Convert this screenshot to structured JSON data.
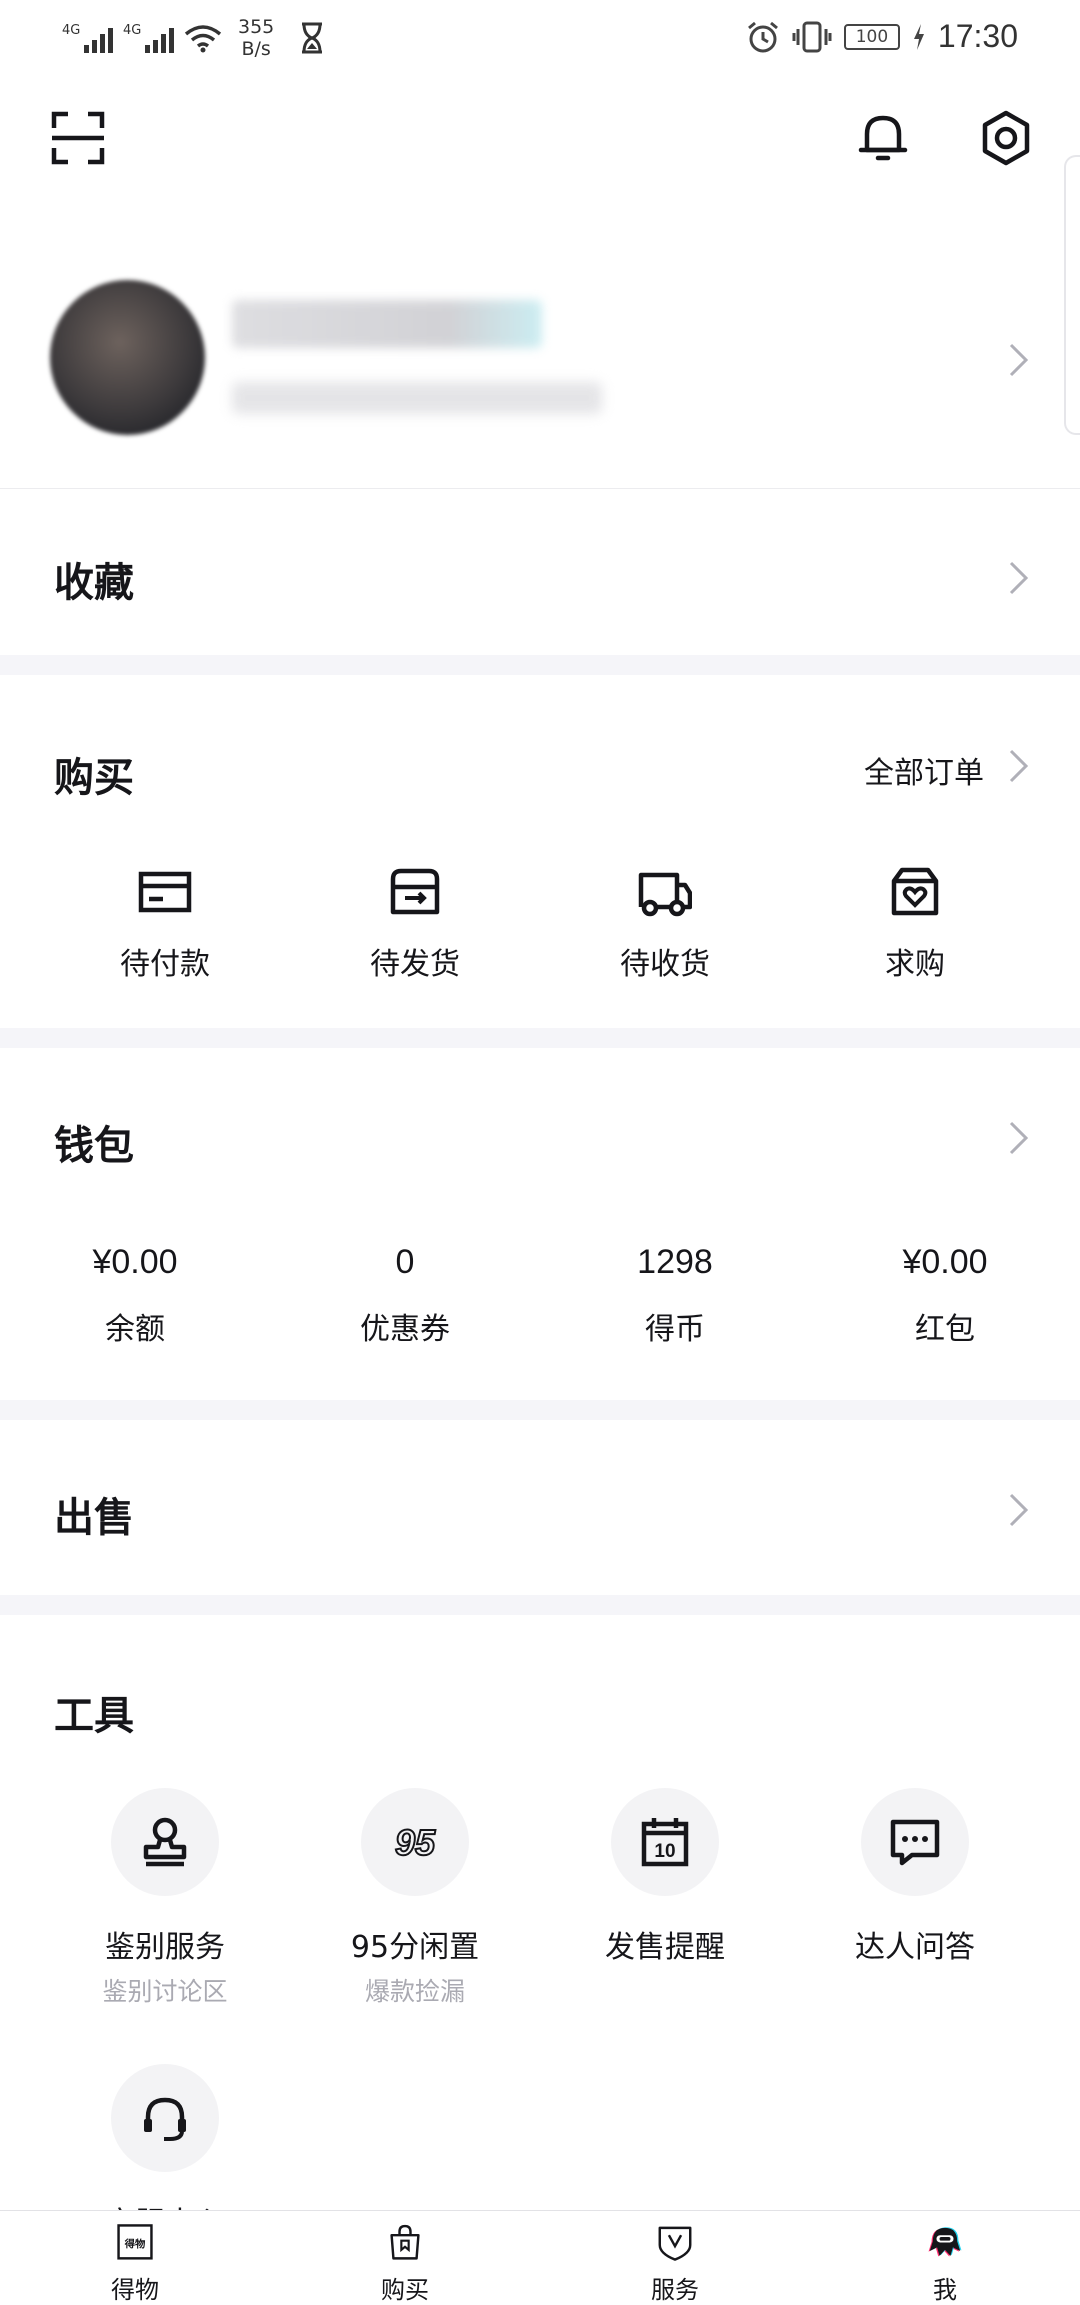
{
  "status_bar": {
    "network_1": "4G",
    "network_2": "4G",
    "net_speed_value": "355",
    "net_speed_unit": "B/s",
    "battery": "100",
    "time": "17:30"
  },
  "header": {
    "icons": [
      "scan-icon",
      "bell-icon",
      "gear-icon"
    ]
  },
  "profile": {
    "name": "",
    "subtitle": ""
  },
  "favorites": {
    "title": "收藏"
  },
  "purchase": {
    "title": "购买",
    "all_orders": "全部订单",
    "items": [
      {
        "label": "待付款",
        "icon": "card-icon"
      },
      {
        "label": "待发货",
        "icon": "box-icon"
      },
      {
        "label": "待收货",
        "icon": "truck-icon"
      },
      {
        "label": "求购",
        "icon": "heart-box-icon"
      }
    ]
  },
  "wallet": {
    "title": "钱包",
    "items": [
      {
        "value": "¥0.00",
        "label": "余额"
      },
      {
        "value": "0",
        "label": "优惠券"
      },
      {
        "value": "1298",
        "label": "得币"
      },
      {
        "value": "¥0.00",
        "label": "红包"
      }
    ]
  },
  "sell": {
    "title": "出售"
  },
  "tools": {
    "title": "工具",
    "items": [
      {
        "label": "鉴别服务",
        "sub": "鉴别讨论区",
        "icon": "stamp-icon"
      },
      {
        "label": "95分闲置",
        "sub": "爆款捡漏",
        "icon": "95-logo-icon"
      },
      {
        "label": "发售提醒",
        "sub": "",
        "icon": "calendar-icon"
      },
      {
        "label": "达人问答",
        "sub": "",
        "icon": "chat-icon"
      },
      {
        "label": "客服中心",
        "sub": "",
        "icon": "headset-icon"
      }
    ]
  },
  "bottom_nav": {
    "items": [
      {
        "label": "得物",
        "icon": "dewu-logo-icon"
      },
      {
        "label": "购买",
        "icon": "shopping-bag-icon"
      },
      {
        "label": "服务",
        "icon": "shield-v-icon"
      },
      {
        "label": "我",
        "icon": "mascot-icon"
      }
    ]
  },
  "colors": {
    "text": "#16161a",
    "muted": "#aaaab2",
    "separator": "#f5f5f9",
    "chevron": "#b0b0b8"
  }
}
